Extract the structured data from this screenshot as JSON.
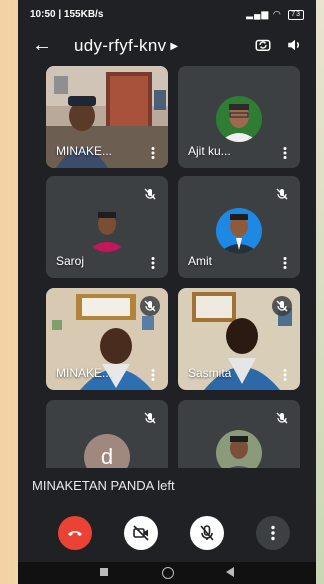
{
  "status_bar": {
    "time": "10:50 | 155KB/s",
    "battery": "73"
  },
  "app_bar": {
    "meeting_code": "udy-rfyf-knv",
    "icons": [
      "back-arrow-icon",
      "chevron-right-icon",
      "camera-switch-icon",
      "speaker-icon"
    ]
  },
  "tiles": [
    {
      "name": "MINAKE..."
    },
    {
      "name": "Ajit ku..."
    },
    {
      "name": "Saroj"
    },
    {
      "name": "Amit"
    },
    {
      "name": "MINAKE..."
    },
    {
      "name": "Sasmita"
    },
    {
      "name": "",
      "avatar_letter": "d"
    },
    {
      "name": ""
    }
  ],
  "toast": {
    "message": "MINAKETAN PANDA left"
  },
  "colors": {
    "background": "#202124",
    "tile": "#3c4043",
    "end_call": "#ea4335"
  }
}
